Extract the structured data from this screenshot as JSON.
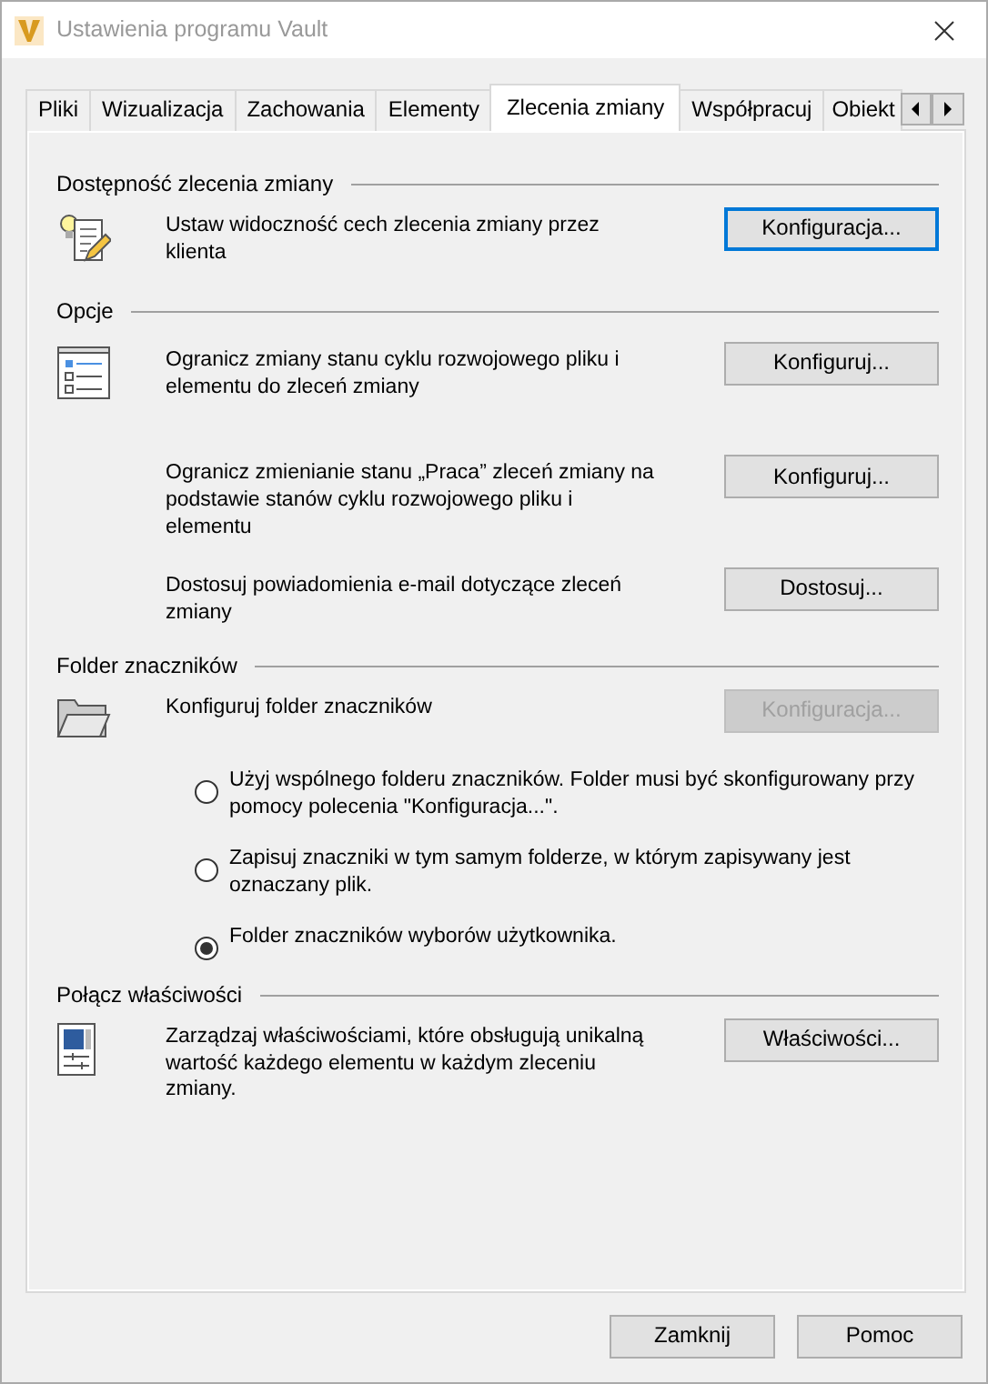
{
  "window": {
    "title": "Ustawienia programu Vault"
  },
  "tabs": [
    {
      "label": "Pliki",
      "selected": false
    },
    {
      "label": "Wizualizacja",
      "selected": false
    },
    {
      "label": "Zachowania",
      "selected": false
    },
    {
      "label": "Elementy",
      "selected": false
    },
    {
      "label": "Zlecenia zmiany",
      "selected": true
    },
    {
      "label": "Współpracuj",
      "selected": false
    },
    {
      "label": "Obiekt",
      "selected": false
    }
  ],
  "sections": [
    {
      "title": "Dostępność zlecenia zmiany",
      "rows": [
        {
          "text": "Ustaw widoczność cech zlecenia zmiany przez klienta",
          "button": {
            "label": "Konfiguracja...",
            "focused": true,
            "disabled": false
          }
        }
      ]
    },
    {
      "title": "Opcje",
      "rows": [
        {
          "text": "Ogranicz zmiany stanu cyklu rozwojowego pliku i elementu do zleceń zmiany",
          "button": {
            "label": "Konfiguruj...",
            "focused": false,
            "disabled": false
          }
        },
        {
          "text": "Ogranicz zmienianie stanu „Praca” zleceń zmiany na podstawie stanów cyklu rozwojowego pliku i elementu",
          "button": {
            "label": "Konfiguruj...",
            "focused": false,
            "disabled": false
          }
        },
        {
          "text": "Dostosuj powiadomienia e-mail dotyczące zleceń zmiany",
          "button": {
            "label": "Dostosuj...",
            "focused": false,
            "disabled": false
          }
        }
      ]
    },
    {
      "title": "Folder znaczników",
      "rows": [
        {
          "text": "Konfiguruj folder znaczników",
          "button": {
            "label": "Konfiguracja...",
            "focused": false,
            "disabled": true
          }
        }
      ],
      "options": [
        {
          "label": "Użyj wspólnego folderu znaczników. Folder musi być skonfigurowany przy pomocy polecenia \"Konfiguracja...\".",
          "selected": false
        },
        {
          "label": "Zapisuj znaczniki w tym samym folderze, w którym zapisywany jest oznaczany plik.",
          "selected": false
        },
        {
          "label": "Folder znaczników wyborów użytkownika.",
          "selected": true
        }
      ]
    },
    {
      "title": "Połącz właściwości",
      "rows": [
        {
          "text": "Zarządzaj właściwościami, które obsługują unikalną wartość każdego elementu w każdym zleceniu zmiany.",
          "button": {
            "label": "Właściwości...",
            "focused": false,
            "disabled": false
          }
        }
      ]
    }
  ],
  "footer_buttons": [
    "Zamknij",
    "Pomoc"
  ]
}
